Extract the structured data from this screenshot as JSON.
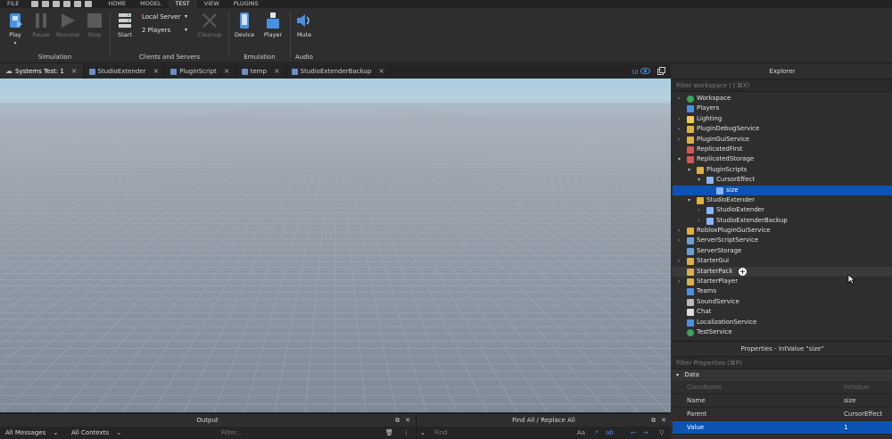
{
  "menu": {
    "items": [
      "FILE",
      "HOME",
      "MODEL",
      "TEST",
      "VIEW",
      "PLUGINS"
    ],
    "active": "TEST"
  },
  "ribbon": {
    "simulation": {
      "label": "Simulation",
      "play": "Play",
      "pause": "Pause",
      "resume": "Resume",
      "stop": "Stop"
    },
    "clients": {
      "label": "Clients and Servers",
      "start": "Start",
      "server": "Local Server",
      "players": "2 Players",
      "cleanup": "Cleanup"
    },
    "emulation": {
      "label": "Emulation",
      "device": "Device",
      "player": "Player"
    },
    "audio": {
      "label": "Audio",
      "mute": "Mute"
    }
  },
  "tabs": [
    {
      "label": "Systems Test: 1"
    },
    {
      "label": "StudioExtender"
    },
    {
      "label": "PluginScript"
    },
    {
      "label": "temp"
    },
    {
      "label": "StudioExtenderBackup"
    }
  ],
  "tab_right": {
    "ui_label": "UI"
  },
  "explorer": {
    "title": "Explorer",
    "filter_placeholder": "Filter workspace (⇧⌘X)",
    "items": [
      {
        "label": "Workspace",
        "icon": "workspace-globe-icon",
        "color": "#3ba55d"
      },
      {
        "label": "Players",
        "icon": "players-icon",
        "color": "#4a90e2"
      },
      {
        "label": "Lighting",
        "icon": "lightbulb-icon",
        "color": "#f2c94c"
      },
      {
        "label": "PluginDebugService",
        "icon": "folder-icon",
        "color": "#e0b040"
      },
      {
        "label": "PluginGuiService",
        "icon": "folder-icon",
        "color": "#e0b040"
      },
      {
        "label": "ReplicatedFirst",
        "icon": "replicated-first-icon",
        "color": "#d9534f"
      },
      {
        "label": "ReplicatedStorage",
        "icon": "replicated-storage-icon",
        "color": "#d9534f"
      },
      {
        "label": "PluginScripts",
        "icon": "folder-icon",
        "color": "#e0b040"
      },
      {
        "label": "CursorEffect",
        "icon": "module-script-icon",
        "color": "#8ab4f8"
      },
      {
        "label": "size",
        "icon": "int-value-icon",
        "color": "#8ab4f8"
      },
      {
        "label": "StudioExtender",
        "icon": "folder-icon",
        "color": "#e0b040"
      },
      {
        "label": "StudioExtender",
        "icon": "module-script-icon",
        "color": "#8ab4f8"
      },
      {
        "label": "StudioExtenderBackup",
        "icon": "module-script-icon",
        "color": "#8ab4f8"
      },
      {
        "label": "RobloxPluginGuiService",
        "icon": "folder-icon",
        "color": "#e0b040"
      },
      {
        "label": "ServerScriptService",
        "icon": "server-script-service-icon",
        "color": "#6aa0d8"
      },
      {
        "label": "ServerStorage",
        "icon": "server-storage-icon",
        "color": "#6aa0d8"
      },
      {
        "label": "StarterGui",
        "icon": "starter-gui-icon",
        "color": "#e0b040"
      },
      {
        "label": "StarterPack",
        "icon": "starter-pack-icon",
        "color": "#e0b040"
      },
      {
        "label": "StarterPlayer",
        "icon": "starter-player-icon",
        "color": "#e0b040"
      },
      {
        "label": "Teams",
        "icon": "teams-icon",
        "color": "#4a90e2"
      },
      {
        "label": "SoundService",
        "icon": "sound-service-icon",
        "color": "#bbbbbb"
      },
      {
        "label": "Chat",
        "icon": "chat-icon",
        "color": "#dddddd"
      },
      {
        "label": "LocalizationService",
        "icon": "localization-icon",
        "color": "#4a90e2"
      },
      {
        "label": "TestService",
        "icon": "test-service-icon",
        "color": "#3ba55d"
      }
    ]
  },
  "properties": {
    "title": "Properties - IntValue \"size\"",
    "filter_placeholder": "Filter Properties (⌘P)",
    "section": "Data",
    "rows": [
      {
        "name": "ClassName",
        "value": "IntValue"
      },
      {
        "name": "Name",
        "value": "size"
      },
      {
        "name": "Parent",
        "value": "CursorEffect"
      },
      {
        "name": "Value",
        "value": "1"
      }
    ]
  },
  "output": {
    "title": "Output",
    "messages_filter": "All Messages",
    "contexts_filter": "All Contexts",
    "filter_placeholder": "Filter..."
  },
  "findall": {
    "title": "Find All / Replace All",
    "find_placeholder": "Find"
  }
}
